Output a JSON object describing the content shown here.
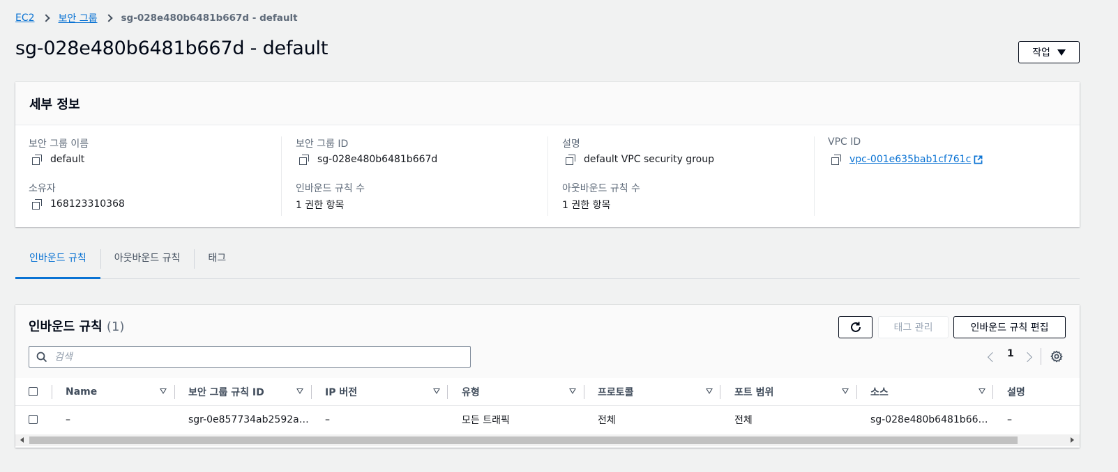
{
  "breadcrumb": {
    "items": [
      "EC2",
      "보안 그룹"
    ],
    "current": "sg-028e480b6481b667d - default"
  },
  "page": {
    "title": "sg-028e480b6481b667d - default",
    "actions_label": "작업"
  },
  "details": {
    "title": "세부 정보",
    "sg_name_label": "보안 그룹 이름",
    "sg_name_value": "default",
    "sg_id_label": "보안 그룹 ID",
    "sg_id_value": "sg-028e480b6481b667d",
    "description_label": "설명",
    "description_value": "default VPC security group",
    "vpc_label": "VPC ID",
    "vpc_value": "vpc-001e635bab1cf761c",
    "owner_label": "소유자",
    "owner_value": "168123310368",
    "inbound_count_label": "인바운드 규칙 수",
    "inbound_count_value": "1 권한 항목",
    "outbound_count_label": "아웃바운드 규칙 수",
    "outbound_count_value": "1 권한 항목"
  },
  "tabs": [
    {
      "label": "인바운드 규칙",
      "active": true
    },
    {
      "label": "아웃바운드 규칙",
      "active": false
    },
    {
      "label": "태그",
      "active": false
    }
  ],
  "inbound_rules": {
    "title": "인바운드 규칙",
    "count": "(1)",
    "manage_tags_label": "태그 관리",
    "edit_rules_label": "인바운드 규칙 편집",
    "search_placeholder": "검색",
    "page_number": "1",
    "columns": [
      "Name",
      "보안 그룹 규칙 ID",
      "IP 버전",
      "유형",
      "프로토콜",
      "포트 범위",
      "소스",
      "설명"
    ],
    "rows": [
      [
        "–",
        "sgr-0e857734ab2592a…",
        "–",
        "모든 트래픽",
        "전체",
        "전체",
        "sg-028e480b6481b66…",
        "–"
      ]
    ]
  },
  "colors": {
    "link": "#0972d3",
    "text": "#16191f",
    "label": "#5f6b7a",
    "background": "#f1f2f2"
  },
  "icons": [
    "chevron-right-icon",
    "caret-down-icon",
    "copy-icon",
    "external-link-icon",
    "refresh-icon",
    "search-icon",
    "chevron-left-icon",
    "settings-gear-icon",
    "sort-caret-icon"
  ]
}
